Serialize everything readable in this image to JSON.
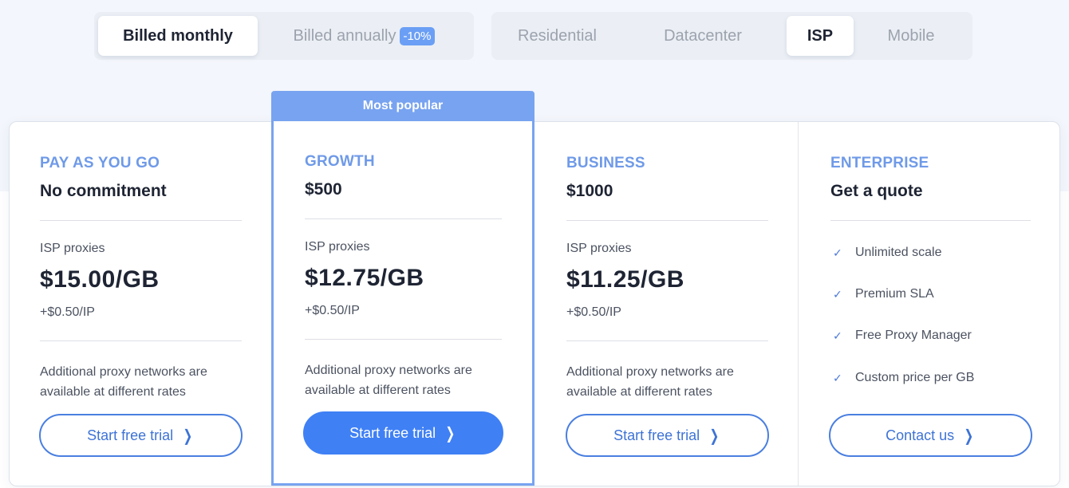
{
  "billing_toggle": {
    "options": [
      {
        "label": "Billed monthly",
        "active": true
      },
      {
        "label": "Billed annually",
        "active": false,
        "badge": "-10%"
      }
    ]
  },
  "proxy_type_toggle": {
    "options": [
      {
        "label": "Residential",
        "active": false
      },
      {
        "label": "Datacenter",
        "active": false
      },
      {
        "label": "ISP",
        "active": true
      },
      {
        "label": "Mobile",
        "active": false
      }
    ]
  },
  "plans": [
    {
      "name": "PAY AS YOU GO",
      "subtitle": "No commitment",
      "proxy_label": "ISP proxies",
      "price": "$15.00/GB",
      "ip_price": "+$0.50/IP",
      "note": "Additional proxy networks are available at different rates",
      "button": "Start free trial"
    },
    {
      "name": "GROWTH",
      "subtitle": "$500",
      "badge": "Most popular",
      "proxy_label": "ISP proxies",
      "price": "$12.75/GB",
      "ip_price": "+$0.50/IP",
      "note": "Additional proxy networks are available at different rates",
      "button": "Start free trial"
    },
    {
      "name": "BUSINESS",
      "subtitle": "$1000",
      "proxy_label": "ISP proxies",
      "price": "$11.25/GB",
      "ip_price": "+$0.50/IP",
      "note": "Additional proxy networks are available at different rates",
      "button": "Start free trial"
    },
    {
      "name": "ENTERPRISE",
      "subtitle": "Get a quote",
      "features": [
        "Unlimited scale",
        "Premium SLA",
        "Free Proxy Manager",
        "Custom price per GB"
      ],
      "button": "Contact us"
    }
  ],
  "icons": {
    "check": "✓",
    "chevron": "❯"
  },
  "colors": {
    "accent": "#3f80f5",
    "featured_border": "#78a3f0",
    "plan_name": "#6f9ae8"
  }
}
